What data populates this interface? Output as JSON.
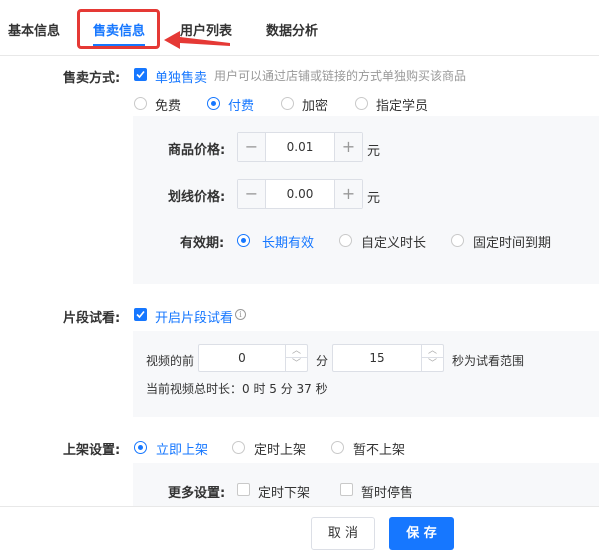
{
  "tabs": [
    {
      "label": "基本信息"
    },
    {
      "label": "售卖信息"
    },
    {
      "label": "用户列表"
    },
    {
      "label": "数据分析"
    }
  ],
  "sale_method": {
    "label": "售卖方式:",
    "checkbox_label": "单独售卖",
    "hint": "用户可以通过店铺或链接的方式单独购买该商品",
    "options": [
      "免费",
      "付费",
      "加密",
      "指定学员"
    ],
    "selected": "付费"
  },
  "price": {
    "label": "商品价格:",
    "value": "0.01",
    "unit": "元"
  },
  "strike_price": {
    "label": "划线价格:",
    "value": "0.00",
    "unit": "元"
  },
  "validity": {
    "label": "有效期:",
    "options": [
      "长期有效",
      "自定义时长",
      "固定时间到期"
    ],
    "selected": "长期有效"
  },
  "trial": {
    "label": "片段试看:",
    "checkbox_label": "开启片段试看",
    "info_glyph": "i",
    "prefix": "视频的前",
    "minutes": "0",
    "minutes_unit": "分",
    "seconds": "15",
    "seconds_suffix": "秒为试看范围",
    "duration_text": "当前视频总时长：0 时 5 分 37 秒"
  },
  "listing": {
    "label": "上架设置:",
    "options": [
      "立即上架",
      "定时上架",
      "暂不上架"
    ],
    "selected": "立即上架",
    "more_label": "更多设置:",
    "more_options": [
      "定时下架",
      "暂时停售"
    ]
  },
  "footer": {
    "cancel_label": "取 消",
    "save_label": "保 存"
  },
  "colors": {
    "accent": "#1677ff",
    "highlight": "#e53935"
  }
}
